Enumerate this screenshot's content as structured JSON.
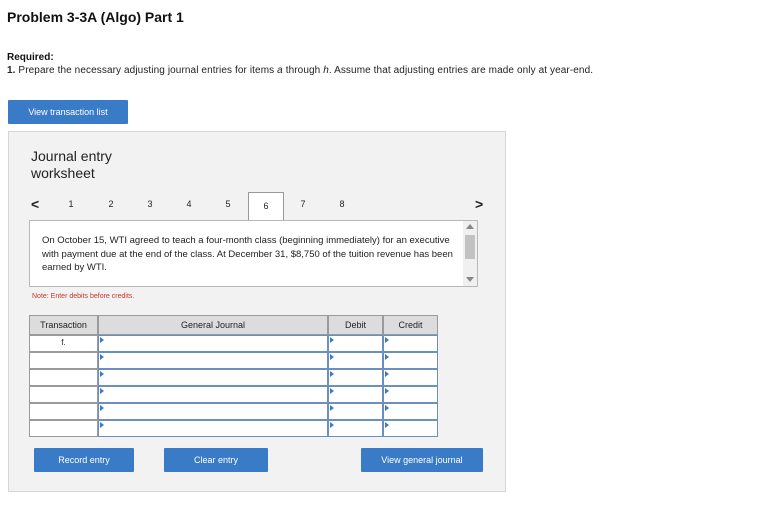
{
  "header": {
    "title": "Problem 3-3A (Algo) Part 1",
    "required_label": "Required:",
    "instruction_number": "1.",
    "instruction_pre": " Prepare the necessary adjusting journal entries for items ",
    "instruction_a": "a",
    "instruction_mid": " through ",
    "instruction_h": "h",
    "instruction_post": ". Assume that adjusting entries are made only at year-end."
  },
  "view_transaction_list_label": "View transaction list",
  "worksheet": {
    "title_line1": "Journal entry",
    "title_line2": "worksheet",
    "prev_arrow": "<",
    "next_arrow": ">",
    "tabs": [
      "1",
      "2",
      "3",
      "4",
      "5",
      "6",
      "7",
      "8"
    ],
    "active_tab": "6",
    "description": "On October 15, WTI agreed to teach a four-month class (beginning immediately) for an executive with payment due at the end of the class. At December 31, $8,750 of the tuition revenue has been earned by WTI.",
    "note": "Note: Enter debits before credits.",
    "table": {
      "headers": {
        "transaction": "Transaction",
        "general_journal": "General Journal",
        "debit": "Debit",
        "credit": "Credit"
      },
      "rows": [
        {
          "transaction": "f.",
          "account": "",
          "debit": "",
          "credit": ""
        },
        {
          "transaction": "",
          "account": "",
          "debit": "",
          "credit": ""
        },
        {
          "transaction": "",
          "account": "",
          "debit": "",
          "credit": ""
        },
        {
          "transaction": "",
          "account": "",
          "debit": "",
          "credit": ""
        },
        {
          "transaction": "",
          "account": "",
          "debit": "",
          "credit": ""
        },
        {
          "transaction": "",
          "account": "",
          "debit": "",
          "credit": ""
        }
      ]
    },
    "buttons": {
      "record": "Record entry",
      "clear": "Clear entry",
      "view_general_journal": "View general journal"
    }
  },
  "colors": {
    "button_blue": "#3a7bc8",
    "panel_bg": "#f2f2f2",
    "note_red": "#c0392b"
  }
}
